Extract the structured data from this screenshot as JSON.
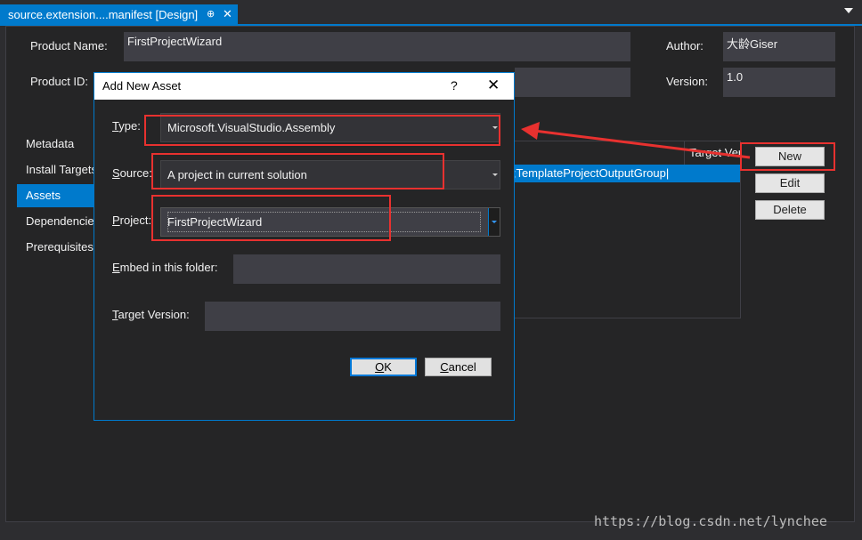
{
  "tab": {
    "title": "source.extension....manifest [Design]",
    "pin_icon": "pin-icon",
    "close_glyph": "✕"
  },
  "header": {
    "product_name_label": "Product Name:",
    "product_name_value": "FirstProjectWizard",
    "product_id_label": "Product ID:",
    "author_label": "Author:",
    "author_value": "大龄Giser",
    "version_label": "Version:",
    "version_value": "1.0"
  },
  "nav": {
    "items": [
      {
        "label": "Metadata"
      },
      {
        "label": "Install Targets"
      },
      {
        "label": "Assets"
      },
      {
        "label": "Dependencies"
      },
      {
        "label": "Prerequisites"
      }
    ],
    "selected": "Assets"
  },
  "assets_grid": {
    "column_header": "Target Version",
    "row_text": "te;TemplateProjectOutputGroup|"
  },
  "asset_buttons": {
    "new": "New",
    "edit": "Edit",
    "delete": "Delete"
  },
  "dialog": {
    "title": "Add New Asset",
    "help_glyph": "?",
    "close_glyph": "✕",
    "type_label_first": "T",
    "type_label_rest": "ype:",
    "type_value": "Microsoft.VisualStudio.Assembly",
    "source_label_first": "S",
    "source_label_rest": "ource:",
    "source_value": "A project in current solution",
    "project_label_first": "P",
    "project_label_rest": "roject:",
    "project_value": "FirstProjectWizard",
    "embed_label_first": "E",
    "embed_label_rest": "mbed in this folder:",
    "embed_value": "",
    "target_label_first": "T",
    "target_label_rest": "arget Version:",
    "target_value": "",
    "ok_first": "O",
    "ok_rest": "K",
    "cancel_first": "C",
    "cancel_rest": "ancel"
  },
  "annotation": {
    "color": "#e8312f"
  },
  "watermark": "https://blog.csdn.net/lynchee"
}
